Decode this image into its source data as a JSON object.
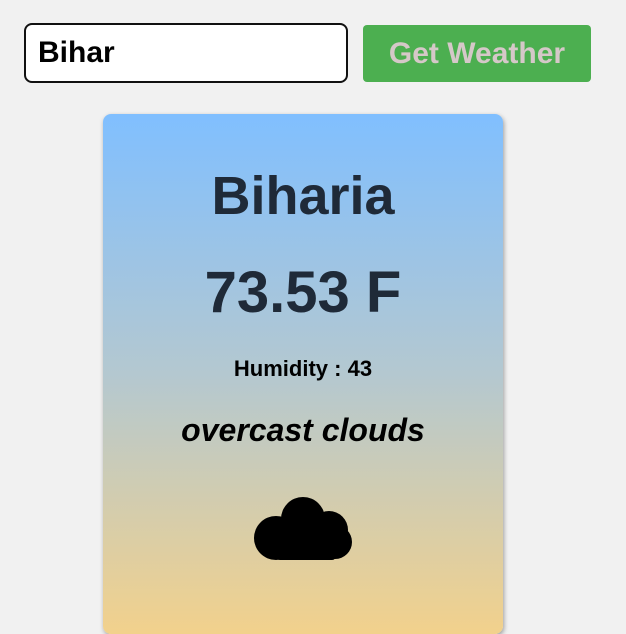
{
  "search": {
    "value": "Bihar"
  },
  "button": {
    "label": "Get Weather",
    "color": "#4caf50"
  },
  "weather": {
    "city": "Biharia",
    "temperature": "73.53 F",
    "humidity": "Humidity : 43",
    "description": "overcast clouds",
    "icon": "cloud-icon"
  }
}
